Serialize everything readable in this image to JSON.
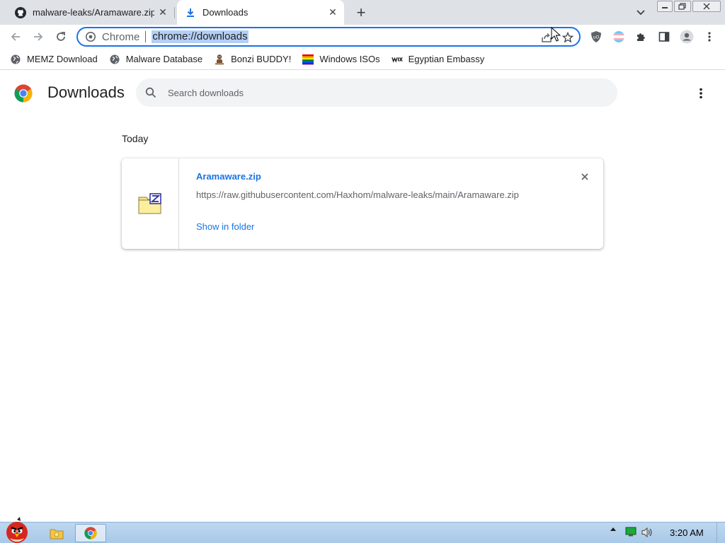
{
  "tabs": [
    {
      "title": "malware-leaks/Aramaware.zip",
      "icon": "github-icon",
      "active": false
    },
    {
      "title": "Downloads",
      "icon": "download-icon",
      "active": true
    }
  ],
  "omnibox": {
    "chip": "Chrome",
    "url": "chrome://downloads"
  },
  "bookmarks": [
    {
      "label": "MEMZ Download",
      "icon": "globe-icon"
    },
    {
      "label": "Malware Database",
      "icon": "globe-icon"
    },
    {
      "label": "Bonzi BUDDY!",
      "icon": "bonzi-icon"
    },
    {
      "label": "Windows ISOs",
      "icon": "rainbow-flag-icon"
    },
    {
      "label": "Egyptian Embassy",
      "icon": "wix-icon"
    }
  ],
  "page": {
    "title": "Downloads",
    "search_placeholder": "Search downloads"
  },
  "downloads": {
    "section": "Today",
    "items": [
      {
        "filename": "Aramaware.zip",
        "url": "https://raw.githubusercontent.com/Haxhom/malware-leaks/main/Aramaware.zip",
        "action": "Show in folder"
      }
    ]
  },
  "taskbar": {
    "clock": "3:20 AM"
  },
  "colors": {
    "accent": "#1a73e8",
    "tabstrip": "#dee1e6",
    "search_bg": "#f1f3f4"
  }
}
